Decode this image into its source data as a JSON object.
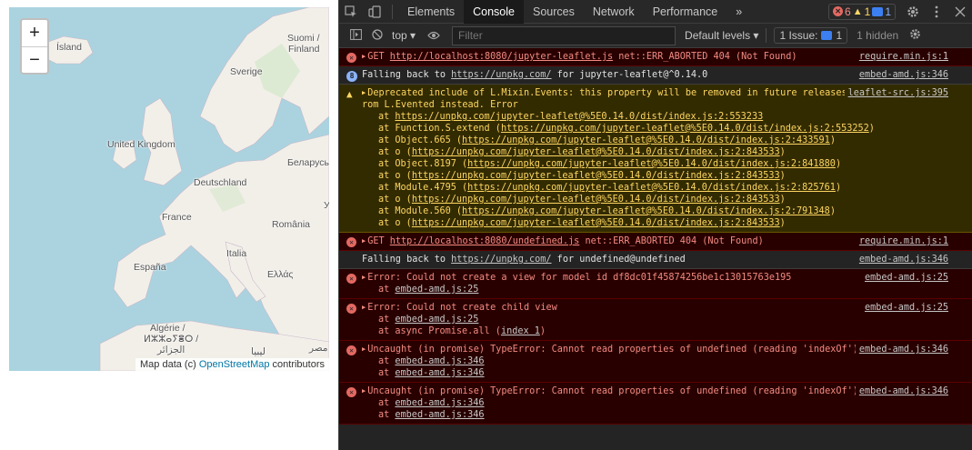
{
  "map": {
    "zoom_in": "+",
    "zoom_out": "−",
    "labels": {
      "island": "Ísland",
      "suomi": "Suomi /",
      "finland": "Finland",
      "sverige": "Sverige",
      "uk": "United Kingdom",
      "belarus": "Беларусь",
      "deutschland": "Deutschland",
      "france": "France",
      "romania": "România",
      "italia": "Italia",
      "espana": "España",
      "ellas": "Ελλάς",
      "algerie": "Algérie /",
      "algerie2": "ⵍⵣⵣⴰⵢⴻⵔ /",
      "algerie3": "الجزائر",
      "libya": "ليبيا",
      "misr": "مصر",
      "ukraine_partial": "У"
    },
    "attribution_prefix": "Map data (c) ",
    "attribution_link": "OpenStreetMap",
    "attribution_suffix": " contributors"
  },
  "devtools": {
    "tabs": [
      "Elements",
      "Console",
      "Sources",
      "Network",
      "Performance"
    ],
    "more": "»",
    "error_count": "6",
    "warning_count": "1",
    "message_count": "1",
    "toolbar": {
      "context": "top ▾",
      "filter_placeholder": "Filter",
      "levels": "Default levels ▾",
      "issues": "1 Issue:",
      "issues_count": "1",
      "hidden": "1 hidden"
    },
    "messages": [
      {
        "kind": "error",
        "text": "GET ",
        "link": "http://localhost:8080/jupyter-leaflet.js",
        "after": " net::ERR_ABORTED 404 (Not Found)",
        "source": "require.min.js:1"
      },
      {
        "kind": "info",
        "badge": "8",
        "text": "Falling back to ",
        "link": "https://unpkg.com/",
        "after": " for jupyter-leaflet@^0.14.0",
        "source": "embed-amd.js:346"
      },
      {
        "kind": "warning",
        "text": "Deprecated include of L.Mixin.Events: this property will be removed in future releases, please inherit from L.Evented instead. Error",
        "source": "leaflet-src.js:395",
        "frames": [
          {
            "pre": "at ",
            "link": "https://unpkg.com/jupyter-leaflet@%5E0.14.0/dist/index.js:2:553233",
            "post": ""
          },
          {
            "pre": "at Function.S.extend (",
            "link": "https://unpkg.com/jupyter-leaflet@%5E0.14.0/dist/index.js:2:553252",
            "post": ")"
          },
          {
            "pre": "at Object.665 (",
            "link": "https://unpkg.com/jupyter-leaflet@%5E0.14.0/dist/index.js:2:433591",
            "post": ")"
          },
          {
            "pre": "at o (",
            "link": "https://unpkg.com/jupyter-leaflet@%5E0.14.0/dist/index.js:2:843533",
            "post": ")"
          },
          {
            "pre": "at Object.8197 (",
            "link": "https://unpkg.com/jupyter-leaflet@%5E0.14.0/dist/index.js:2:841880",
            "post": ")"
          },
          {
            "pre": "at o (",
            "link": "https://unpkg.com/jupyter-leaflet@%5E0.14.0/dist/index.js:2:843533",
            "post": ")"
          },
          {
            "pre": "at Module.4795 (",
            "link": "https://unpkg.com/jupyter-leaflet@%5E0.14.0/dist/index.js:2:825761",
            "post": ")"
          },
          {
            "pre": "at o (",
            "link": "https://unpkg.com/jupyter-leaflet@%5E0.14.0/dist/index.js:2:843533",
            "post": ")"
          },
          {
            "pre": "at Module.560 (",
            "link": "https://unpkg.com/jupyter-leaflet@%5E0.14.0/dist/index.js:2:791348",
            "post": ")"
          },
          {
            "pre": "at o (",
            "link": "https://unpkg.com/jupyter-leaflet@%5E0.14.0/dist/index.js:2:843533",
            "post": ")"
          }
        ]
      },
      {
        "kind": "error",
        "text": "GET ",
        "link": "http://localhost:8080/undefined.js",
        "after": " net::ERR_ABORTED 404 (Not Found)",
        "source": "require.min.js:1"
      },
      {
        "kind": "info",
        "text": "Falling back to ",
        "link": "https://unpkg.com/",
        "after": " for undefined@undefined",
        "source": "embed-amd.js:346"
      },
      {
        "kind": "error",
        "text": "Error: Could not create a view for model id df8dc01f45874256be1c13015763e195",
        "source": "embed-amd.js:25",
        "frames": [
          {
            "pre": "at ",
            "link": "embed-amd.js:25",
            "post": ""
          }
        ]
      },
      {
        "kind": "error",
        "text": "Error: Could not create child view",
        "source": "embed-amd.js:25",
        "frames": [
          {
            "pre": "at ",
            "link": "embed-amd.js:25",
            "post": ""
          },
          {
            "pre": "at async Promise.all (",
            "link": "index 1",
            "post": ")"
          }
        ]
      },
      {
        "kind": "error",
        "text": "Uncaught (in promise) TypeError: Cannot read properties of undefined (reading 'indexOf')",
        "source": "embed-amd.js:346",
        "frames": [
          {
            "pre": "at ",
            "link": "embed-amd.js:346",
            "post": ""
          },
          {
            "pre": "at ",
            "link": "embed-amd.js:346",
            "post": ""
          }
        ]
      },
      {
        "kind": "error",
        "text": "Uncaught (in promise) TypeError: Cannot read properties of undefined (reading 'indexOf')",
        "source": "embed-amd.js:346",
        "frames": [
          {
            "pre": "at ",
            "link": "embed-amd.js:346",
            "post": ""
          },
          {
            "pre": "at ",
            "link": "embed-amd.js:346",
            "post": ""
          }
        ]
      }
    ]
  }
}
